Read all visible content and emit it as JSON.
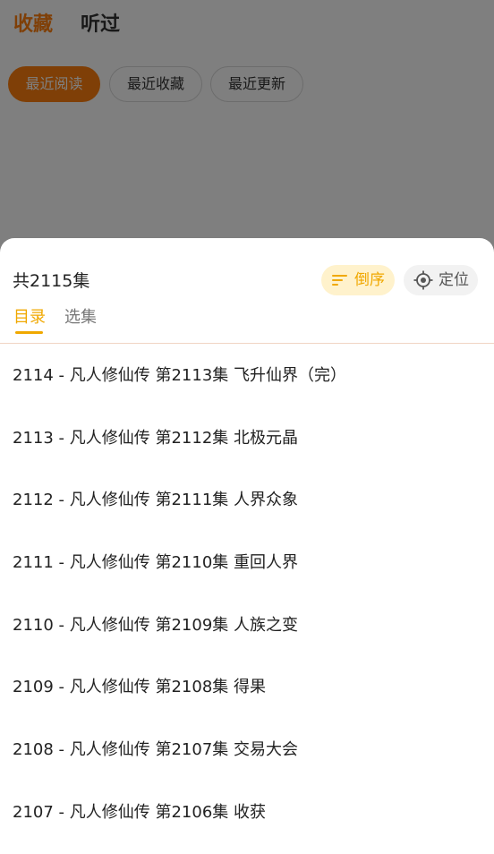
{
  "top_tabs": {
    "favorites": "收藏",
    "history": "听过"
  },
  "filters": {
    "recent_read": "最近阅读",
    "recent_favorite": "最近收藏",
    "recent_update": "最近更新"
  },
  "sheet": {
    "count_text": "共2115集",
    "sort_label": "倒序",
    "locate_label": "定位",
    "tabs": {
      "catalog": "目录",
      "select": "选集"
    },
    "episodes": [
      "2114 - 凡人修仙传 第2113集 飞升仙界（完）",
      "2113 - 凡人修仙传 第2112集 北极元晶",
      "2112 - 凡人修仙传 第2111集 人界众象",
      "2111 - 凡人修仙传 第2110集 重回人界",
      "2110 - 凡人修仙传 第2109集 人族之变",
      "2109 - 凡人修仙传 第2108集 得果",
      "2108 - 凡人修仙传 第2107集 交易大会",
      "2107 - 凡人修仙传 第2106集 收获"
    ]
  },
  "colors": {
    "accent_orange": "#ff7f0e",
    "accent_yellow": "#f0a800"
  },
  "icons": {
    "sort": "sort-lines-icon",
    "locate": "crosshair-icon"
  }
}
